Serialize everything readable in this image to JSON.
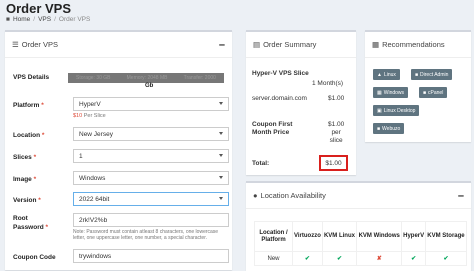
{
  "page": {
    "title": "Order VPS"
  },
  "breadcrumb": {
    "home": "Home",
    "vps": "VPS",
    "current": "Order VPS"
  },
  "order": {
    "title": "Order VPS",
    "vps_details_label": "VPS Details",
    "specs": {
      "storage": "Storage: 30 GB",
      "memory": "Memory: 2048 MB",
      "transfer": "Transfer: 2000",
      "tail": "Gb"
    },
    "platform": {
      "label": "Platform",
      "value": "HyperV",
      "price": "$10",
      "price_suffix": " Per Slice"
    },
    "location": {
      "label": "Location",
      "value": "New Jersey"
    },
    "slices": {
      "label": "Slices",
      "value": "1"
    },
    "image": {
      "label": "Image",
      "value": "Windows"
    },
    "version": {
      "label": "Version",
      "value": "2022 64bit"
    },
    "root_password": {
      "label_line1": "Root",
      "label_line2": "Password",
      "value": "2rk!V2%b",
      "note": "Note: Password must contain atleast 8 characters, one lowercase letter, one uppercase letter, one number, a special character."
    },
    "coupon": {
      "label": "Coupon Code",
      "value": "trywindows"
    }
  },
  "summary": {
    "title": "Order Summary",
    "item_name": "Hyper-V VPS Slice",
    "item_qty": "1 Month(s)",
    "hostname": "server.domain.com",
    "hostname_price": "$1.00",
    "coupon_line1": "Coupon First",
    "coupon_line2": "Month Price",
    "coupon_price": "$1.00",
    "coupon_per1": "per",
    "coupon_per2": "slice",
    "total_label": "Total:",
    "total_value": "$1.00"
  },
  "recommendations": {
    "title": "Recommendations",
    "buttons": [
      "Linux",
      "Direct Admin",
      "Windows",
      "cPanel",
      "Linux Desktop",
      "Webuzo"
    ]
  },
  "locations": {
    "title": "Location Availability",
    "headers": [
      "Location / Platform",
      "Virtuozzo",
      "KVM Linux",
      "KVM Windows",
      "HyperV",
      "KVM Storage"
    ],
    "rows": [
      {
        "name": "New",
        "status": [
          "yes",
          "yes",
          "no",
          "yes",
          "yes"
        ]
      }
    ]
  }
}
